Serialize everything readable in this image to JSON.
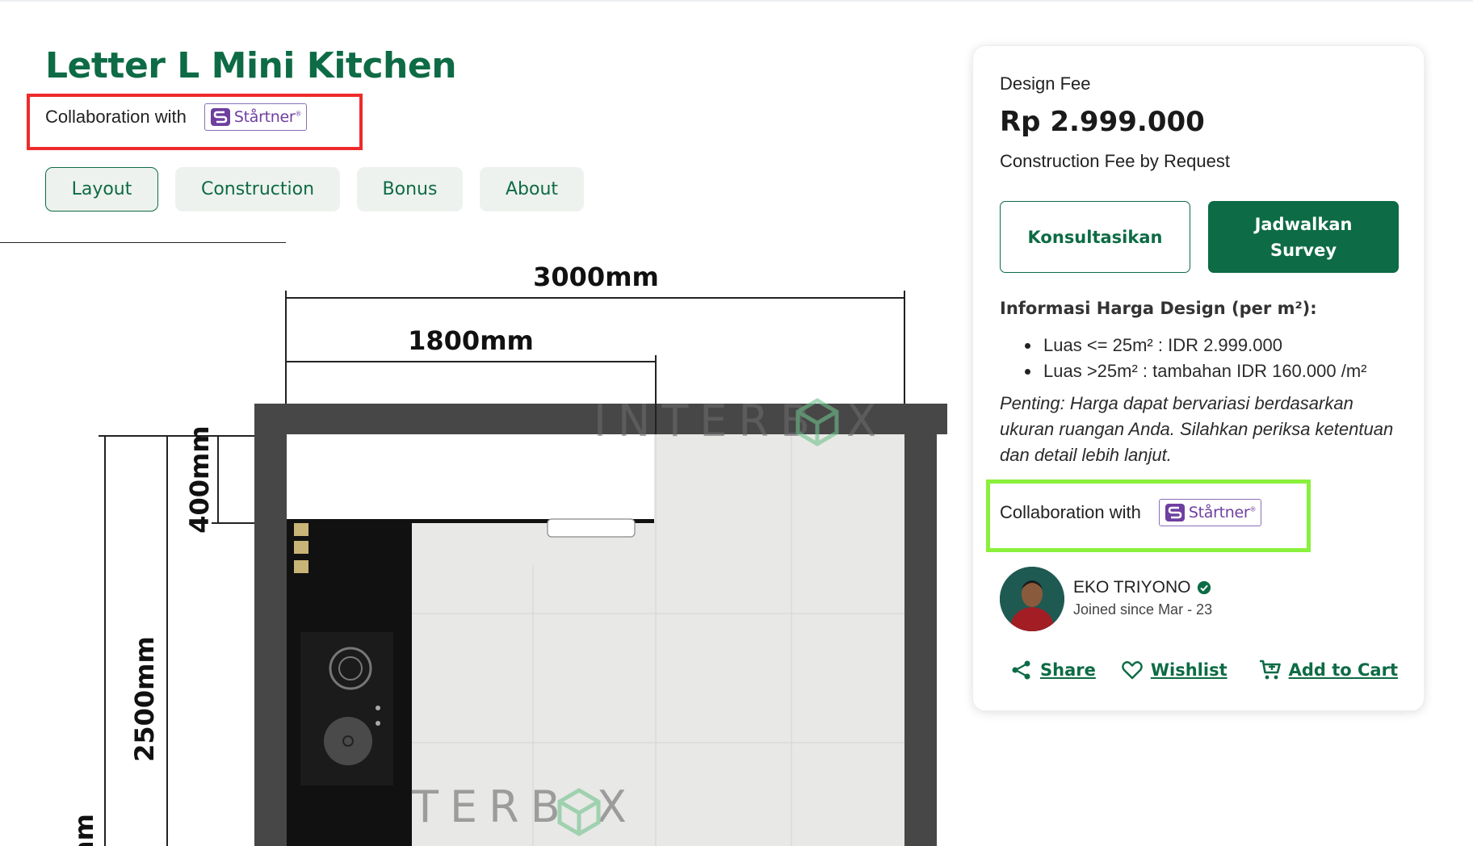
{
  "product": {
    "title": "Letter L Mini Kitchen",
    "collaboration_label": "Collaboration with",
    "partner_name": "Stårtner",
    "partner_mark": "®"
  },
  "tabs": [
    {
      "label": "Layout",
      "active": true
    },
    {
      "label": "Construction",
      "active": false
    },
    {
      "label": "Bonus",
      "active": false
    },
    {
      "label": "About",
      "active": false
    }
  ],
  "floor_plan": {
    "dim_total_width": "3000mm",
    "dim_counter_width": "1800mm",
    "dim_counter_depth": "400mm",
    "dim_room_depth": "2500mm",
    "dim_partial": "mm",
    "watermark_top": "INTERB X",
    "watermark_bottom": "TERB X"
  },
  "pricing": {
    "fee_label": "Design Fee",
    "price": "Rp 2.999.000",
    "construction_note": "Construction Fee by Request",
    "consult_button": "Konsultasikan",
    "survey_button": "Jadwalkan Survey",
    "info_title": "Informasi Harga Design (per m²):",
    "info_items": [
      "Luas <= 25m² : IDR 2.999.000",
      "Luas >25m² : tambahan IDR 160.000 /m²"
    ],
    "note": "Penting: Harga dapat bervariasi berdasarkan ukuran ruangan Anda. Silahkan periksa ketentuan dan detail lebih lanjut."
  },
  "author": {
    "name": "EKO TRIYONO",
    "joined": "Joined since Mar - 23"
  },
  "actions": {
    "share": "Share",
    "wishlist": "Wishlist",
    "cart": "Add to Cart"
  },
  "colors": {
    "brand_green": "#0d6b45",
    "highlight_red": "#ee2b2b",
    "highlight_lime": "#89f03c",
    "partner_purple": "#6f3fa0"
  },
  "icons": [
    "startner-logo-icon",
    "verified-icon",
    "share-icon",
    "heart-icon",
    "cart-icon",
    "interbox-cube-icon"
  ]
}
